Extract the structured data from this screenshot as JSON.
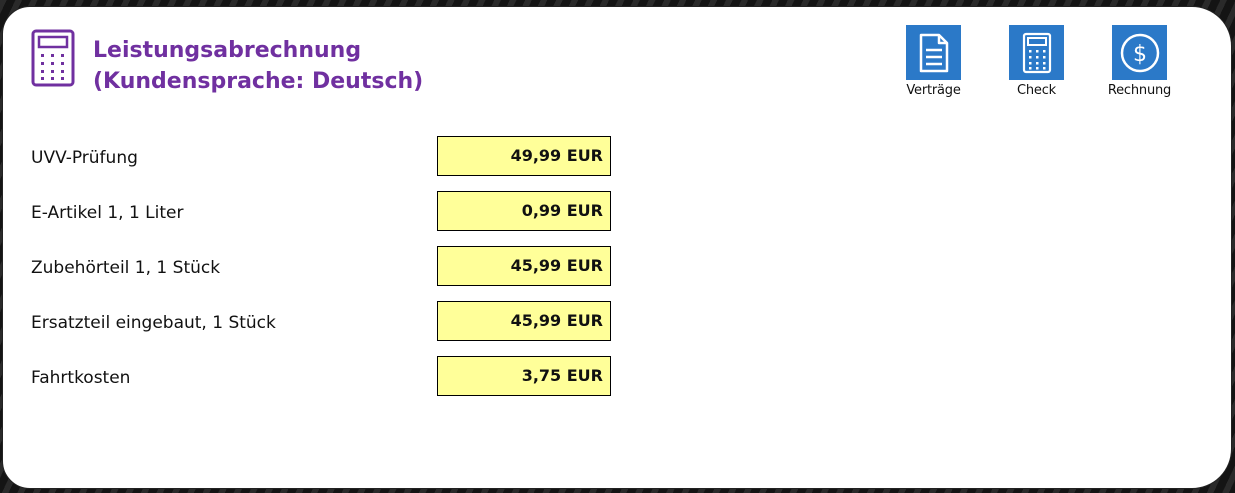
{
  "header": {
    "title_line1": "Leistungsabrechnung",
    "title_line2": "(Kundensprache: Deutsch)",
    "icon": "calculator-icon",
    "title_color": "#7030a0"
  },
  "actions": [
    {
      "label": "Verträge",
      "icon": "document-icon"
    },
    {
      "label": "Check",
      "icon": "calculator-icon"
    },
    {
      "label": "Rechnung",
      "icon": "dollar-icon"
    }
  ],
  "action_tile_color": "#2b79c8",
  "value_field_color": "#ffff99",
  "items": [
    {
      "label": "UVV-Prüfung",
      "value": "49,99 EUR"
    },
    {
      "label": "E-Artikel 1, 1 Liter",
      "value": "0,99 EUR"
    },
    {
      "label": "Zubehörteil 1, 1 Stück",
      "value": "45,99 EUR"
    },
    {
      "label": "Ersatzteil eingebaut, 1 Stück",
      "value": "45,99 EUR"
    },
    {
      "label": "Fahrtkosten",
      "value": "3,75 EUR"
    }
  ]
}
